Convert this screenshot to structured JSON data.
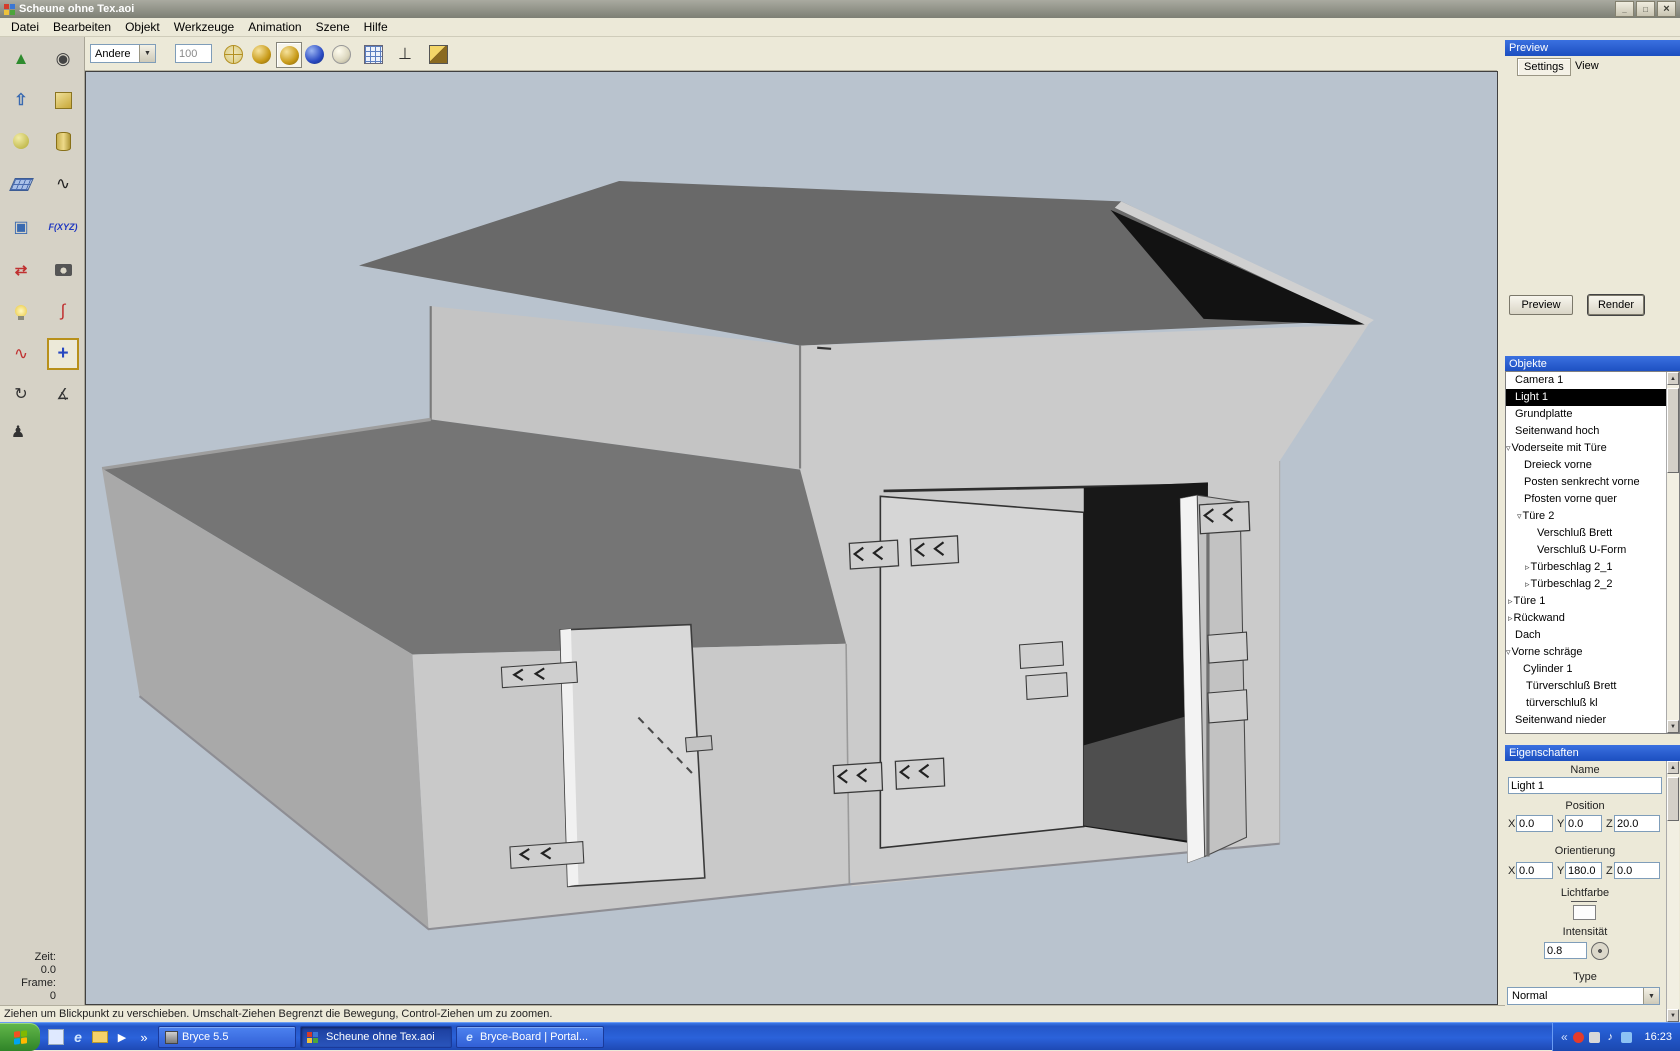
{
  "window": {
    "title": "Scheune ohne Tex.aoi"
  },
  "menubar": {
    "items": [
      "Datei",
      "Bearbeiten",
      "Objekt",
      "Werkzeuge",
      "Animation",
      "Szene",
      "Hilfe"
    ]
  },
  "toolbar": {
    "mode_value": "Andere",
    "field_value": "100"
  },
  "palette": {
    "fxyz": "F(XYZ)",
    "time_label": "Zeit:",
    "time_value": "0.0",
    "frame_label": "Frame:",
    "frame_value": "0"
  },
  "statusbar": {
    "text": "Ziehen um Blickpunkt zu verschieben. Umschalt-Ziehen Begrenzt die Bewegung, Control-Ziehen um zu zoomen."
  },
  "preview": {
    "title": "Preview",
    "tab_settings": "Settings",
    "tab_view": "View",
    "preview_button": "Preview",
    "render_button": "Render"
  },
  "objects": {
    "title": "Objekte",
    "items": [
      {
        "label": "Camera 1",
        "arrow": ""
      },
      {
        "label": "Light 1",
        "arrow": ""
      },
      {
        "label": "Grundplatte",
        "arrow": ""
      },
      {
        "label": "Seitenwand hoch",
        "arrow": ""
      },
      {
        "label": "Voderseite mit Türe",
        "arrow": "▿"
      },
      {
        "label": "Dreieck vorne",
        "arrow": ""
      },
      {
        "label": "Posten senkrecht vorne",
        "arrow": ""
      },
      {
        "label": "Pfosten vorne quer",
        "arrow": ""
      },
      {
        "label": "Türe 2",
        "arrow": "▿"
      },
      {
        "label": "Verschluß Brett",
        "arrow": ""
      },
      {
        "label": "Verschluß U-Form",
        "arrow": ""
      },
      {
        "label": "Türbeschlag 2_1",
        "arrow": "▹"
      },
      {
        "label": "Türbeschlag 2_2",
        "arrow": "▹"
      },
      {
        "label": "Türe 1",
        "arrow": "▹"
      },
      {
        "label": "Rückwand",
        "arrow": "▹"
      },
      {
        "label": "Dach",
        "arrow": ""
      },
      {
        "label": "Vorne schräge",
        "arrow": "▿"
      },
      {
        "label": "Cylinder 1",
        "arrow": ""
      },
      {
        "label": "Türverschluß Brett",
        "arrow": ""
      },
      {
        "label": "türverschluß kl",
        "arrow": ""
      },
      {
        "label": "Seitenwand nieder",
        "arrow": ""
      }
    ]
  },
  "props": {
    "title": "Eigenschaften",
    "name_label": "Name",
    "name_value": "Light 1",
    "position_label": "Position",
    "x_label": "X",
    "y_label": "Y",
    "z_label": "Z",
    "pos": {
      "x": "0.0",
      "y": "0.0",
      "z": "20.0"
    },
    "orientation_label": "Orientierung",
    "ori": {
      "x": "0.0",
      "y": "180.0",
      "z": "0.0"
    },
    "lightcolor_label": "Lichtfarbe",
    "intensity_label": "Intensität",
    "intensity_value": "0.8",
    "type_label": "Type",
    "type_value": "Normal"
  },
  "taskbar": {
    "tasks": [
      {
        "label": "Bryce 5.5"
      },
      {
        "label": "Scheune ohne Tex.aoi"
      },
      {
        "label": "Bryce-Board | Portal..."
      }
    ],
    "clock": "16:23"
  },
  "colors": {
    "viewport_bg": "#b9c3ce",
    "panel_header_blue": "#2057cf",
    "selection_bg": "#000000",
    "taskbar_blue": "#2a5ade",
    "roof_gray": "#696969",
    "wall_gray": "#cbcbcb"
  }
}
